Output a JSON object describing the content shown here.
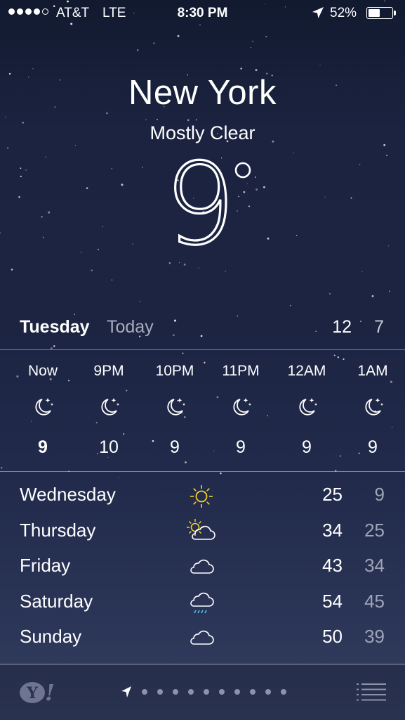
{
  "status_bar": {
    "signal_bars_filled": 4,
    "signal_bars_total": 5,
    "carrier": "AT&T",
    "network": "LTE",
    "time": "8:30 PM",
    "battery_percent_label": "52%",
    "battery_level": 0.52
  },
  "hero": {
    "city": "New York",
    "condition": "Mostly Clear",
    "temperature": "9",
    "degree_symbol": "°"
  },
  "today": {
    "day": "Tuesday",
    "label": "Today",
    "high": "12",
    "low": "7"
  },
  "hourly": [
    {
      "time": "Now",
      "icon": "moon-stars-icon",
      "temp": "9"
    },
    {
      "time": "9PM",
      "icon": "moon-stars-icon",
      "temp": "10"
    },
    {
      "time": "10PM",
      "icon": "moon-stars-icon",
      "temp": "9"
    },
    {
      "time": "11PM",
      "icon": "moon-stars-icon",
      "temp": "9"
    },
    {
      "time": "12AM",
      "icon": "moon-stars-icon",
      "temp": "9"
    },
    {
      "time": "1AM",
      "icon": "moon-stars-icon",
      "temp": "9"
    }
  ],
  "daily": [
    {
      "day": "Wednesday",
      "icon": "sun-icon",
      "high": "25",
      "low": "9"
    },
    {
      "day": "Thursday",
      "icon": "partly-sunny-icon",
      "high": "34",
      "low": "25"
    },
    {
      "day": "Friday",
      "icon": "cloud-icon",
      "high": "43",
      "low": "34"
    },
    {
      "day": "Saturday",
      "icon": "rain-cloud-icon",
      "high": "54",
      "low": "45"
    },
    {
      "day": "Sunday",
      "icon": "cloud-icon",
      "high": "50",
      "low": "39"
    }
  ],
  "toolbar": {
    "logo": "yahoo-logo",
    "logo_letter": "Y",
    "logo_mark": "!",
    "page_count": 10,
    "list_icon": "list-icon"
  },
  "colors": {
    "sun": "#f5cf2a",
    "rain": "#53b8e8",
    "secondary_text": "#9ea3b6"
  }
}
